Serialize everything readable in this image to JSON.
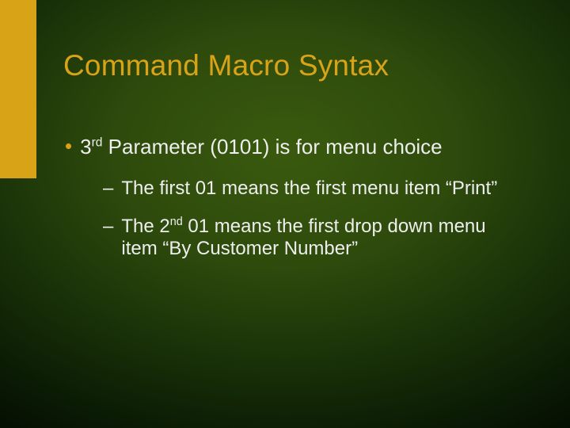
{
  "slide": {
    "title": "Command Macro Syntax",
    "bullet": {
      "marker": "•",
      "text_pre": "3",
      "text_sup": "rd",
      "text_post": " Parameter (0101) is for menu choice"
    },
    "subs": [
      {
        "dash": "–",
        "text": "The first 01 means the first menu item “Print”"
      },
      {
        "dash": "–",
        "text_pre": "The 2",
        "text_sup": "nd",
        "text_post": " 01 means the first drop down menu item “By Customer Number”"
      }
    ]
  }
}
